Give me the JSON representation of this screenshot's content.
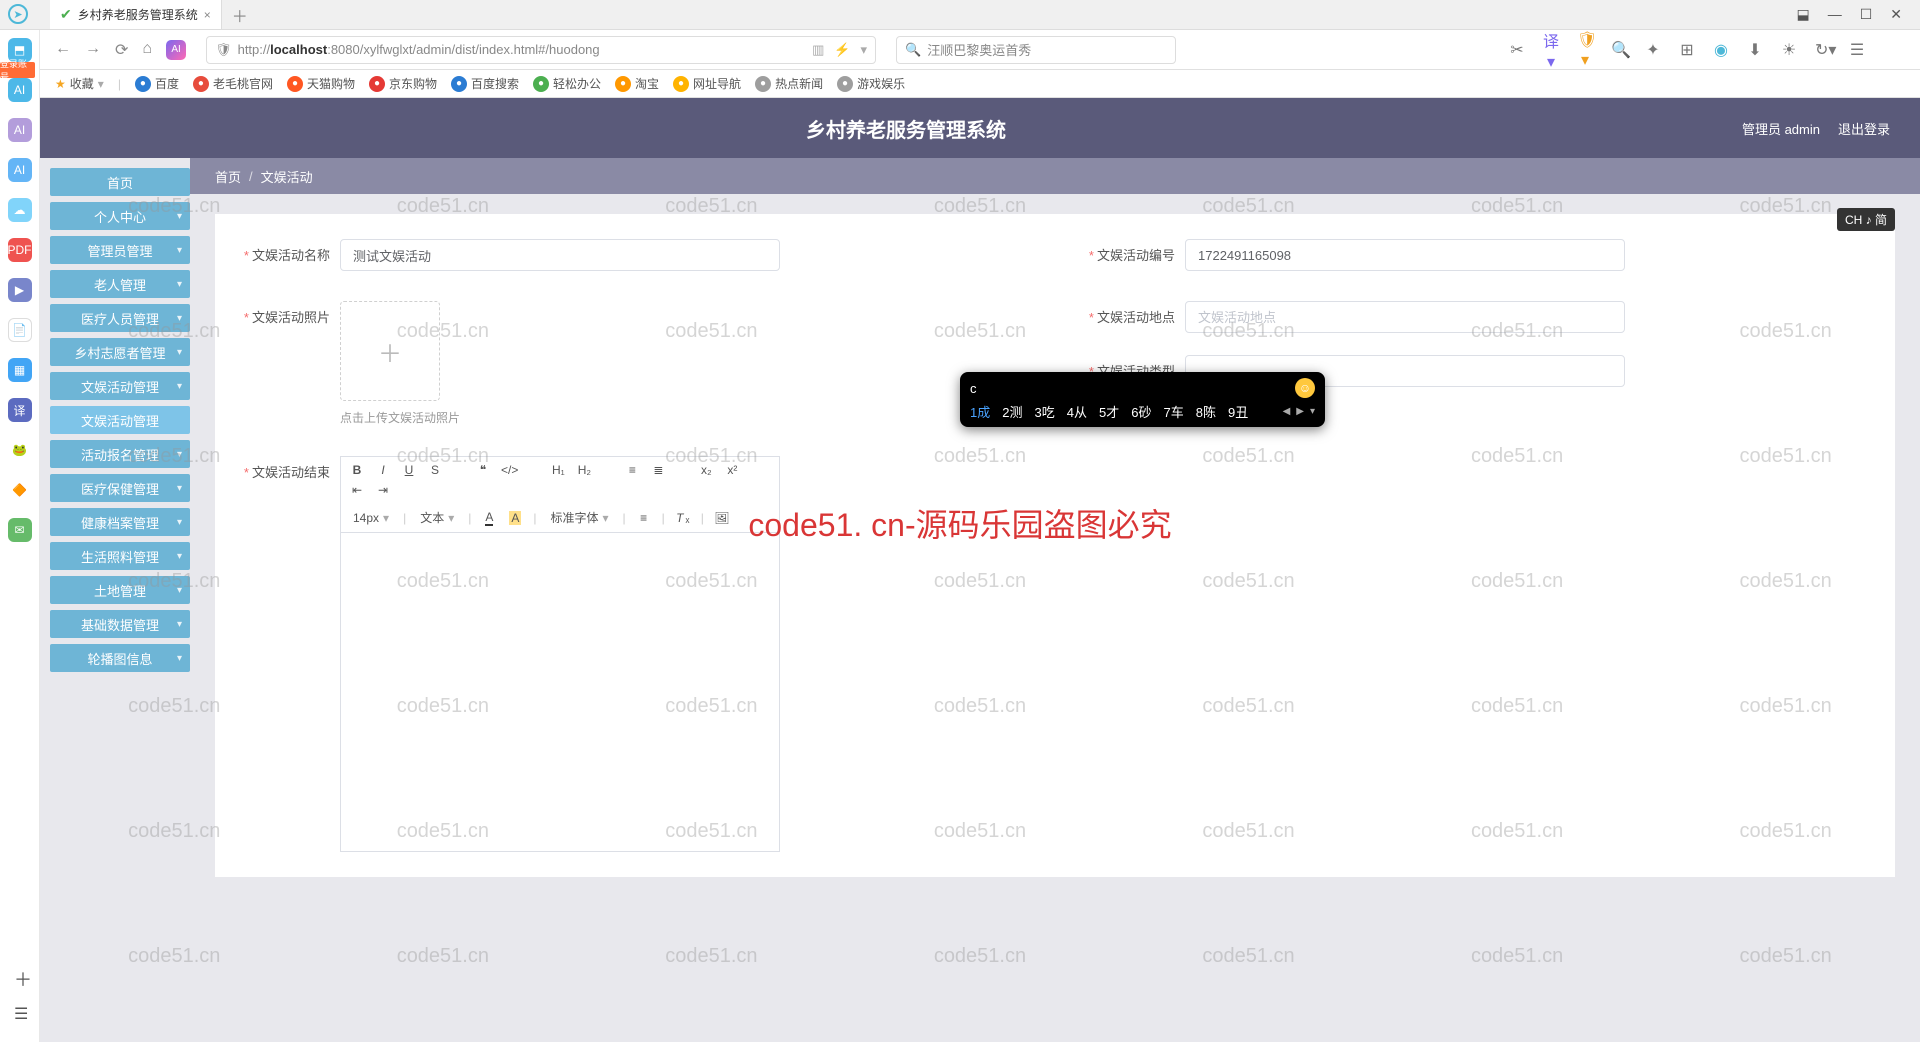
{
  "browser": {
    "tab_title": "乡村养老服务管理系统",
    "url_prefix": "http://",
    "url_host": "localhost",
    "url_port_path": ":8080/xylfwglxt/admin/dist/index.html#/huodong",
    "search_placeholder": "汪顺巴黎奥运首秀",
    "fav_label": "收藏"
  },
  "bookmarks": [
    {
      "label": "百度",
      "color": "#2b7cd3"
    },
    {
      "label": "老毛桃官网",
      "color": "#e74c3c"
    },
    {
      "label": "天猫购物",
      "color": "#ff5722"
    },
    {
      "label": "京东购物",
      "color": "#e53935"
    },
    {
      "label": "百度搜索",
      "color": "#2b7cd3"
    },
    {
      "label": "轻松办公",
      "color": "#4caf50"
    },
    {
      "label": "淘宝",
      "color": "#ff9800"
    },
    {
      "label": "网址导航",
      "color": "#ffb300"
    },
    {
      "label": "热点新闻",
      "color": "#9e9e9e"
    },
    {
      "label": "游戏娱乐",
      "color": "#9e9e9e"
    }
  ],
  "app": {
    "title": "乡村养老服务管理系统",
    "user_label": "管理员 admin",
    "logout": "退出登录"
  },
  "sidebar": [
    {
      "label": "首页",
      "exp": false
    },
    {
      "label": "个人中心",
      "exp": true
    },
    {
      "label": "管理员管理",
      "exp": true
    },
    {
      "label": "老人管理",
      "exp": true
    },
    {
      "label": "医疗人员管理",
      "exp": true
    },
    {
      "label": "乡村志愿者管理",
      "exp": true
    },
    {
      "label": "文娱活动管理",
      "exp": true
    },
    {
      "label": "文娱活动管理",
      "exp": false,
      "sub": true
    },
    {
      "label": "活动报名管理",
      "exp": true
    },
    {
      "label": "医疗保健管理",
      "exp": true
    },
    {
      "label": "健康档案管理",
      "exp": true
    },
    {
      "label": "生活照料管理",
      "exp": true
    },
    {
      "label": "土地管理",
      "exp": true
    },
    {
      "label": "基础数据管理",
      "exp": true
    },
    {
      "label": "轮播图信息",
      "exp": true
    }
  ],
  "breadcrumb": {
    "home": "首页",
    "current": "文娱活动"
  },
  "form": {
    "name_label": "文娱活动名称",
    "name_value": "测试文娱活动",
    "code_label": "文娱活动编号",
    "code_value": "1722491165098",
    "location_label": "文娱活动地点",
    "location_placeholder": "文娱活动地点",
    "photo_label": "文娱活动照片",
    "photo_hint": "点击上传文娱活动照片",
    "type_label": "文娱活动类型",
    "result_label": "文娱活动结束"
  },
  "editor": {
    "font_size": "14px",
    "block": "文本",
    "font": "标准字体"
  },
  "ime": {
    "input": "c",
    "candidates": [
      {
        "n": "1",
        "t": "成"
      },
      {
        "n": "2",
        "t": "测"
      },
      {
        "n": "3",
        "t": "吃"
      },
      {
        "n": "4",
        "t": "从"
      },
      {
        "n": "5",
        "t": "才"
      },
      {
        "n": "6",
        "t": "砂"
      },
      {
        "n": "7",
        "t": "车"
      },
      {
        "n": "8",
        "t": "陈"
      },
      {
        "n": "9",
        "t": "丑"
      }
    ]
  },
  "ime_badge": "CH ♪ 简",
  "watermark": "code51.cn",
  "watermark_center": "code51. cn-源码乐园盗图必究",
  "red_tag": "登录账号"
}
